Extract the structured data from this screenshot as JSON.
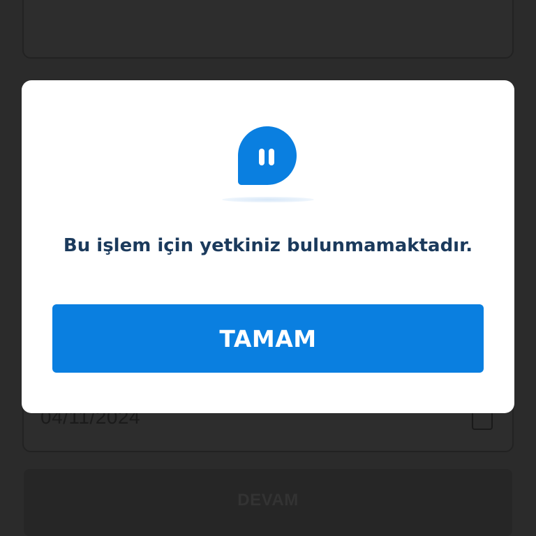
{
  "background_page": {
    "date_value": "04/11/2024",
    "continue_label": "DEVAM"
  },
  "dialog": {
    "icon": "chat-bubble-pause-icon",
    "message": "Bu işlem için yetkiniz bulunmamaktadır.",
    "ok_label": "TAMAM"
  },
  "colors": {
    "accent": "#0a7fe0",
    "message_text": "#1b3a5c",
    "overlay": "#2b2b2b"
  }
}
